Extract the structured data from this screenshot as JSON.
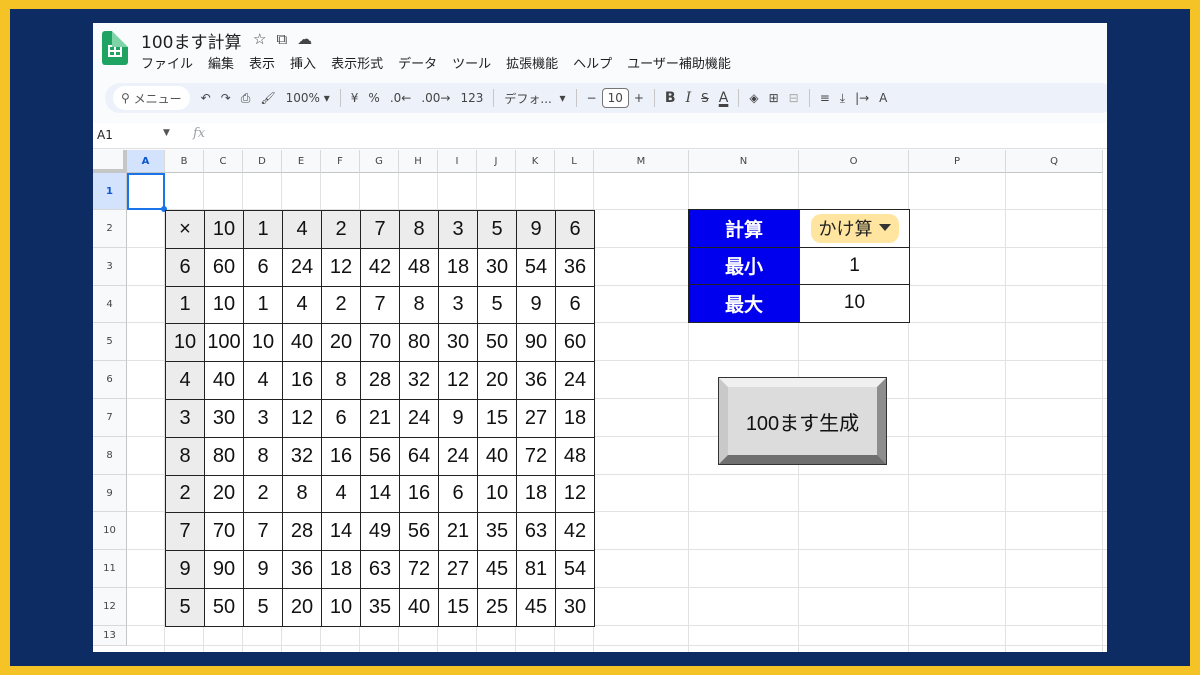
{
  "document_title": "100ます計算",
  "title_icons": [
    "star-icon",
    "folder-move-icon",
    "cloud-icon"
  ],
  "menu": [
    "ファイル",
    "編集",
    "表示",
    "挿入",
    "表示形式",
    "データ",
    "ツール",
    "拡張機能",
    "ヘルプ",
    "ユーザー補助機能"
  ],
  "toolbar": {
    "search_placeholder": "メニュー",
    "undo": "↶",
    "redo": "↷",
    "print": "⎙",
    "paint_format": "🖌",
    "zoom": "100%",
    "currency": "¥",
    "percent": "%",
    "decrease_decimal": ".0←",
    "increase_decimal": ".00→",
    "number_format": "123",
    "font": "デフォ...",
    "font_minus": "−",
    "font_size": "10",
    "font_plus": "+",
    "bold": "B",
    "italic": "I",
    "strike": "S",
    "text_color": "A",
    "fill_color": "◈",
    "borders": "⊞",
    "merge": "⊟",
    "halign": "≡",
    "valign": "⤓",
    "text_dir": "|→",
    "more": "A"
  },
  "name_box": "A1",
  "fx": "fx",
  "columns": [
    "A",
    "B",
    "C",
    "D",
    "E",
    "F",
    "G",
    "H",
    "I",
    "J",
    "K",
    "L",
    "M",
    "N",
    "O",
    "P",
    "Q"
  ],
  "rows": [
    "1",
    "2",
    "3",
    "4",
    "5",
    "6",
    "7",
    "8",
    "9",
    "10",
    "11",
    "12",
    "13"
  ],
  "grid": {
    "corner": "×",
    "top_header": [
      "10",
      "1",
      "4",
      "2",
      "7",
      "8",
      "3",
      "5",
      "9",
      "6"
    ],
    "left_header": [
      "6",
      "1",
      "10",
      "4",
      "3",
      "8",
      "2",
      "7",
      "9",
      "5"
    ],
    "body": [
      [
        "60",
        "6",
        "24",
        "12",
        "42",
        "48",
        "18",
        "30",
        "54",
        "36"
      ],
      [
        "10",
        "1",
        "4",
        "2",
        "7",
        "8",
        "3",
        "5",
        "9",
        "6"
      ],
      [
        "100",
        "10",
        "40",
        "20",
        "70",
        "80",
        "30",
        "50",
        "90",
        "60"
      ],
      [
        "40",
        "4",
        "16",
        "8",
        "28",
        "32",
        "12",
        "20",
        "36",
        "24"
      ],
      [
        "30",
        "3",
        "12",
        "6",
        "21",
        "24",
        "9",
        "15",
        "27",
        "18"
      ],
      [
        "80",
        "8",
        "32",
        "16",
        "56",
        "64",
        "24",
        "40",
        "72",
        "48"
      ],
      [
        "20",
        "2",
        "8",
        "4",
        "14",
        "16",
        "6",
        "10",
        "18",
        "12"
      ],
      [
        "70",
        "7",
        "28",
        "14",
        "49",
        "56",
        "21",
        "35",
        "63",
        "42"
      ],
      [
        "90",
        "9",
        "36",
        "18",
        "63",
        "72",
        "27",
        "45",
        "81",
        "54"
      ],
      [
        "50",
        "5",
        "20",
        "10",
        "35",
        "40",
        "15",
        "25",
        "45",
        "30"
      ]
    ]
  },
  "settings": {
    "calc_label": "計算",
    "calc_value": "かけ算",
    "min_label": "最小",
    "min_value": "1",
    "max_label": "最大",
    "max_value": "10"
  },
  "generate_button": "100ます生成",
  "colors": {
    "frame": "#f6c326",
    "background": "#0c2c63",
    "label_fill": "#0000ee",
    "dropdown_chip": "#ffe5a0"
  }
}
